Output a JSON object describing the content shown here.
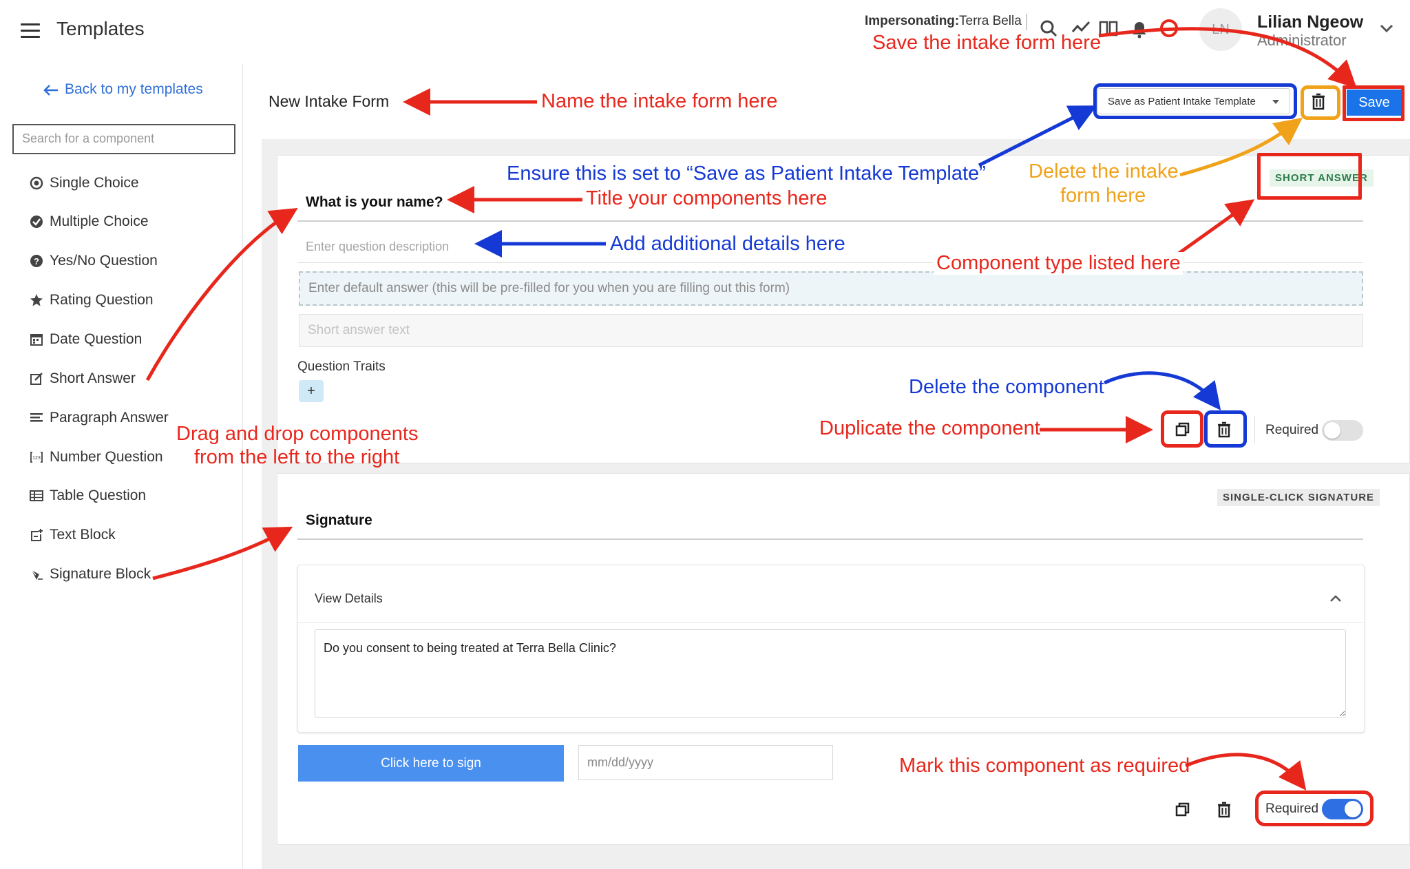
{
  "topbar": {
    "app_title": "Templates",
    "impersonating_label": "Impersonating:",
    "impersonating_value": "Terra Bella",
    "avatar_initials": "LN",
    "user_name": "Lilian Ngeow",
    "user_role": "Administrator"
  },
  "sidebar": {
    "back_link": "Back to my templates",
    "search_placeholder": "Search for a component",
    "components": [
      {
        "label": "Single Choice",
        "icon": "radio-icon"
      },
      {
        "label": "Multiple Choice",
        "icon": "check-circle-icon"
      },
      {
        "label": "Yes/No Question",
        "icon": "question-circle-icon"
      },
      {
        "label": "Rating Question",
        "icon": "star-icon"
      },
      {
        "label": "Date Question",
        "icon": "calendar-icon"
      },
      {
        "label": "Short Answer",
        "icon": "edit-icon"
      },
      {
        "label": "Paragraph Answer",
        "icon": "paragraph-icon"
      },
      {
        "label": "Number Question",
        "icon": "number-icon"
      },
      {
        "label": "Table Question",
        "icon": "table-icon"
      },
      {
        "label": "Text Block",
        "icon": "text-block-icon"
      },
      {
        "label": "Signature Block",
        "icon": "signature-icon"
      }
    ]
  },
  "header": {
    "form_name": "New Intake Form",
    "template_select": "Save as Patient Intake Template",
    "save_label": "Save"
  },
  "card1": {
    "badge": "SHORT ANSWER",
    "question_title": "What is your name?",
    "description_placeholder": "Enter question description",
    "default_answer_placeholder": "Enter default answer (this will be pre-filled for you when you are filling out this form)",
    "short_answer_placeholder": "Short answer text",
    "traits_label": "Question Traits",
    "traits_add": "+",
    "required_label": "Required",
    "required": false
  },
  "card2": {
    "badge": "SINGLE-CLICK SIGNATURE",
    "title": "Signature",
    "details_label": "View Details",
    "consent_text": "Do you consent to being treated at Terra Bella Clinic?",
    "sign_button": "Click here to sign",
    "date_placeholder": "mm/dd/yyyy",
    "required_label": "Required",
    "required": true
  },
  "annotations": {
    "save_here": "Save the intake form here",
    "name_here": "Name the intake form here",
    "ensure_template": "Ensure this is set to “Save as Patient Intake Template”",
    "title_components": "Title your components here",
    "delete_form_1": "Delete the intake",
    "delete_form_2": "form here",
    "additional_details": "Add additional details here",
    "component_type": "Component type listed here",
    "delete_component": "Delete the component",
    "duplicate_component": "Duplicate the component",
    "drag_drop_1": "Drag and drop components",
    "drag_drop_2": "from the left to the right",
    "mark_required": "Mark this component as required"
  },
  "colors": {
    "annotation_red": "#e8271c",
    "annotation_blue": "#1539d4",
    "annotation_orange": "#f0a21a",
    "primary": "#1a73e8",
    "sign_button": "#4a90ef"
  }
}
